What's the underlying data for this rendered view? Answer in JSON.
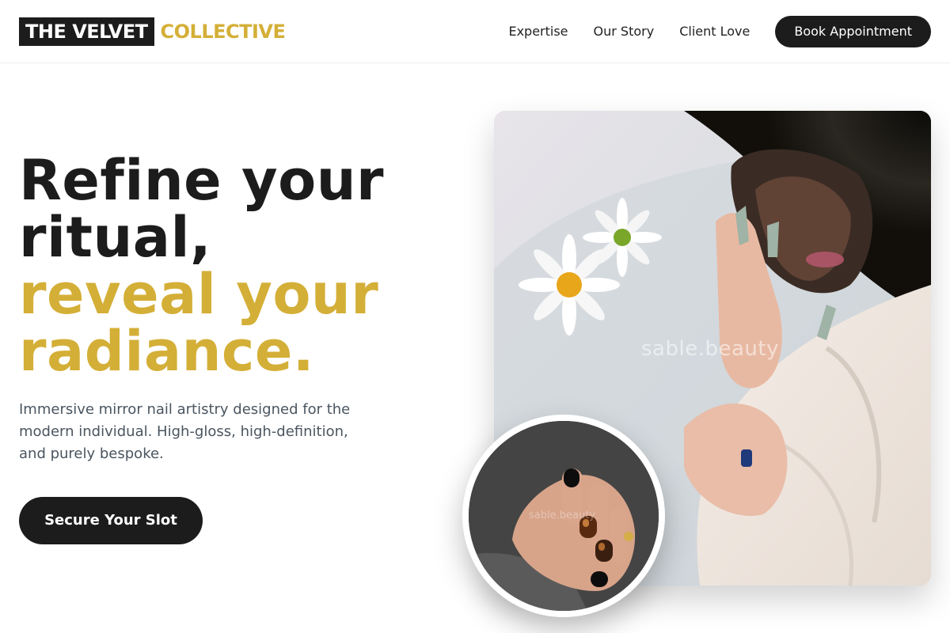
{
  "brand": {
    "name_main": "THE VELVET",
    "name_accent": "COLLECTIVE",
    "accent_color": "#d4af37",
    "dark_color": "#1c1c1c"
  },
  "nav": {
    "links": [
      "Expertise",
      "Our Story",
      "Client Love"
    ],
    "cta_label": "Book Appointment"
  },
  "hero": {
    "title_dark": [
      "Refine your",
      "ritual,"
    ],
    "title_gold": [
      "reveal your",
      "radiance."
    ],
    "subtitle_lines": [
      "Immersive mirror nail artistry designed for the",
      "modern individual. High-gloss, high-definition,",
      "and purely bespoke."
    ],
    "cta_label": "Secure Your Slot"
  },
  "media": {
    "main_photo_watermark": "sable.beauty",
    "inset_photo_watermark": "sable.beauty",
    "main_photo_icon": "model-with-daisies-photo",
    "inset_photo_icon": "manicured-hand-photo"
  }
}
